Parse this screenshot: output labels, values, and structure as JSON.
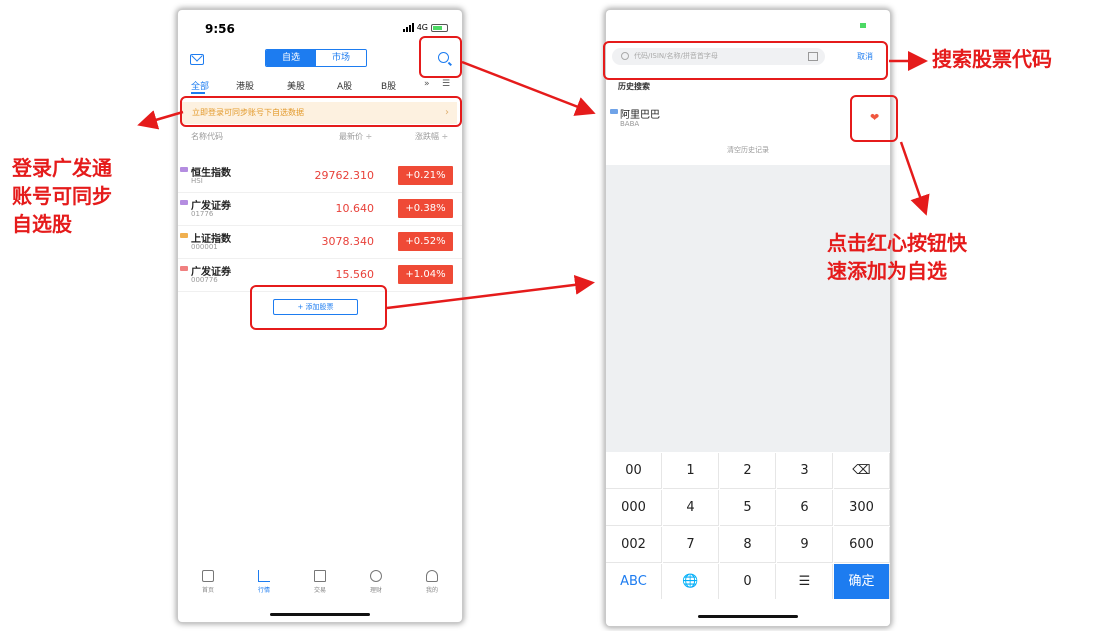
{
  "phone1": {
    "status": {
      "time": "9:56",
      "network": "4G"
    },
    "segments": [
      "自选",
      "市场"
    ],
    "tabs": [
      "全部",
      "港股",
      "美股",
      "A股",
      "B股"
    ],
    "banner": "立即登录可同步账号下自选数据",
    "columns": {
      "name": "名称代码",
      "price": "最新价 ÷",
      "change": "涨跌幅 ÷"
    },
    "stocks": [
      {
        "name": "恒生指数",
        "code": "HSI",
        "price": "29762.310",
        "change": "+0.21%",
        "color": "#b48de0"
      },
      {
        "name": "广发证券",
        "code": "01776",
        "price": "10.640",
        "change": "+0.38%",
        "color": "#b48de0"
      },
      {
        "name": "上证指数",
        "code": "000001",
        "price": "3078.340",
        "change": "+0.52%",
        "color": "#f0b050"
      },
      {
        "name": "广发证券",
        "code": "000776",
        "price": "15.560",
        "change": "+1.04%",
        "color": "#f08080"
      }
    ],
    "add_button": "+ 添加股票",
    "nav": [
      "首页",
      "行情",
      "交易",
      "理财",
      "我的"
    ]
  },
  "phone2": {
    "search_placeholder": "代码/ISIN/名称/拼音首字母",
    "cancel": "取消",
    "history_title": "历史搜索",
    "history_item": {
      "name": "阿里巴巴",
      "code": "BABA"
    },
    "clear_history": "清空历史记录",
    "keys": [
      [
        "00",
        "1",
        "2",
        "3",
        "⌫"
      ],
      [
        "000",
        "4",
        "5",
        "6",
        "300"
      ],
      [
        "002",
        "7",
        "8",
        "9",
        "600"
      ],
      [
        "ABC",
        "🌐",
        "0",
        "☰",
        "确定"
      ]
    ]
  },
  "annotations": {
    "left": [
      "登录广发通",
      "账号可同步",
      "自选股"
    ],
    "search": "搜索股票代码",
    "heart": [
      "点击红心按钮快",
      "速添加为自选"
    ]
  },
  "colors": {
    "accent": "#1d7cf0",
    "up": "#ef4a36",
    "annotation": "#e51b1b"
  }
}
